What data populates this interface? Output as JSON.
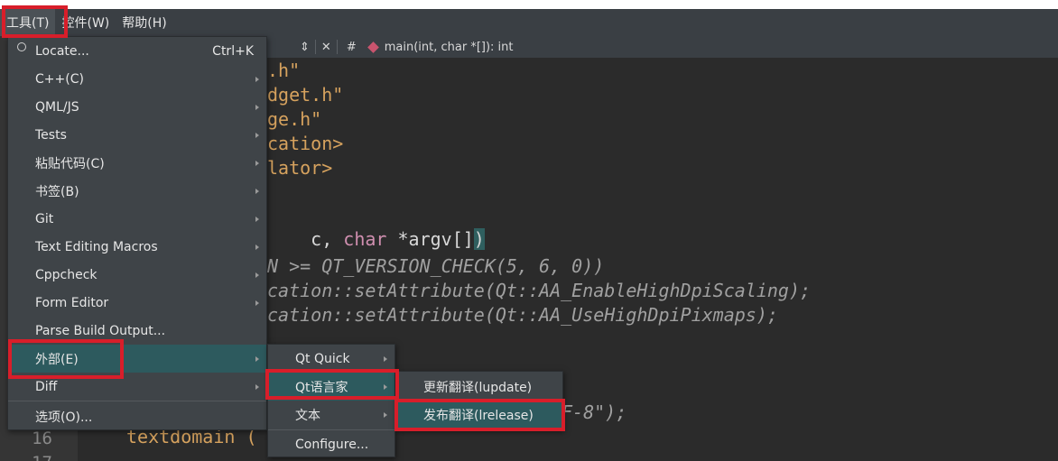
{
  "menubar": {
    "items": [
      {
        "label": "工具(T)"
      },
      {
        "label": "控件(W)"
      },
      {
        "label": "帮助(H)"
      }
    ]
  },
  "toolbar": {
    "arrows": "⇕",
    "close": "✕",
    "hash": "#",
    "function": "main(int, char *[]): int"
  },
  "code": {
    "lines": [
      ".h\"",
      "dget.h\"",
      "ge.h\"",
      "cation>",
      "lator>",
      "c, char *argv[])",
      "N >= QT_VERSION_CHECK(5, 6, 0))",
      "cation::setAttribute(Qt::AA_EnableHighDpiScaling);",
      "cation::setAttribute(Qt::AA_UseHighDpiPixmaps);",
      "F-8\");",
      "textdomain ("
    ]
  },
  "line_numbers": [
    "16",
    "17"
  ],
  "tools_menu": {
    "items": [
      {
        "label": "Locate...",
        "shortcut": "Ctrl+K"
      },
      {
        "label": "C++(C)"
      },
      {
        "label": "QML/JS"
      },
      {
        "label": "Tests"
      },
      {
        "label": "粘贴代码(C)"
      },
      {
        "label": "书签(B)"
      },
      {
        "label": "Git"
      },
      {
        "label": "Text Editing Macros"
      },
      {
        "label": "Cppcheck"
      },
      {
        "label": "Form Editor"
      },
      {
        "label": "Parse Build Output..."
      },
      {
        "label": "外部(E)"
      },
      {
        "label": "Diff"
      },
      {
        "label": "选项(O)..."
      }
    ]
  },
  "external_menu": {
    "items": [
      {
        "label": "Qt Quick"
      },
      {
        "label": "Qt语言家"
      },
      {
        "label": "文本"
      },
      {
        "label": "Configure..."
      }
    ]
  },
  "linguist_menu": {
    "items": [
      {
        "label": "更新翻译(lupdate)"
      },
      {
        "label": "发布翻译(lrelease)"
      }
    ]
  },
  "colors": {
    "highlight": "#2d5a5e",
    "annotation_red": "#d81e2a"
  }
}
